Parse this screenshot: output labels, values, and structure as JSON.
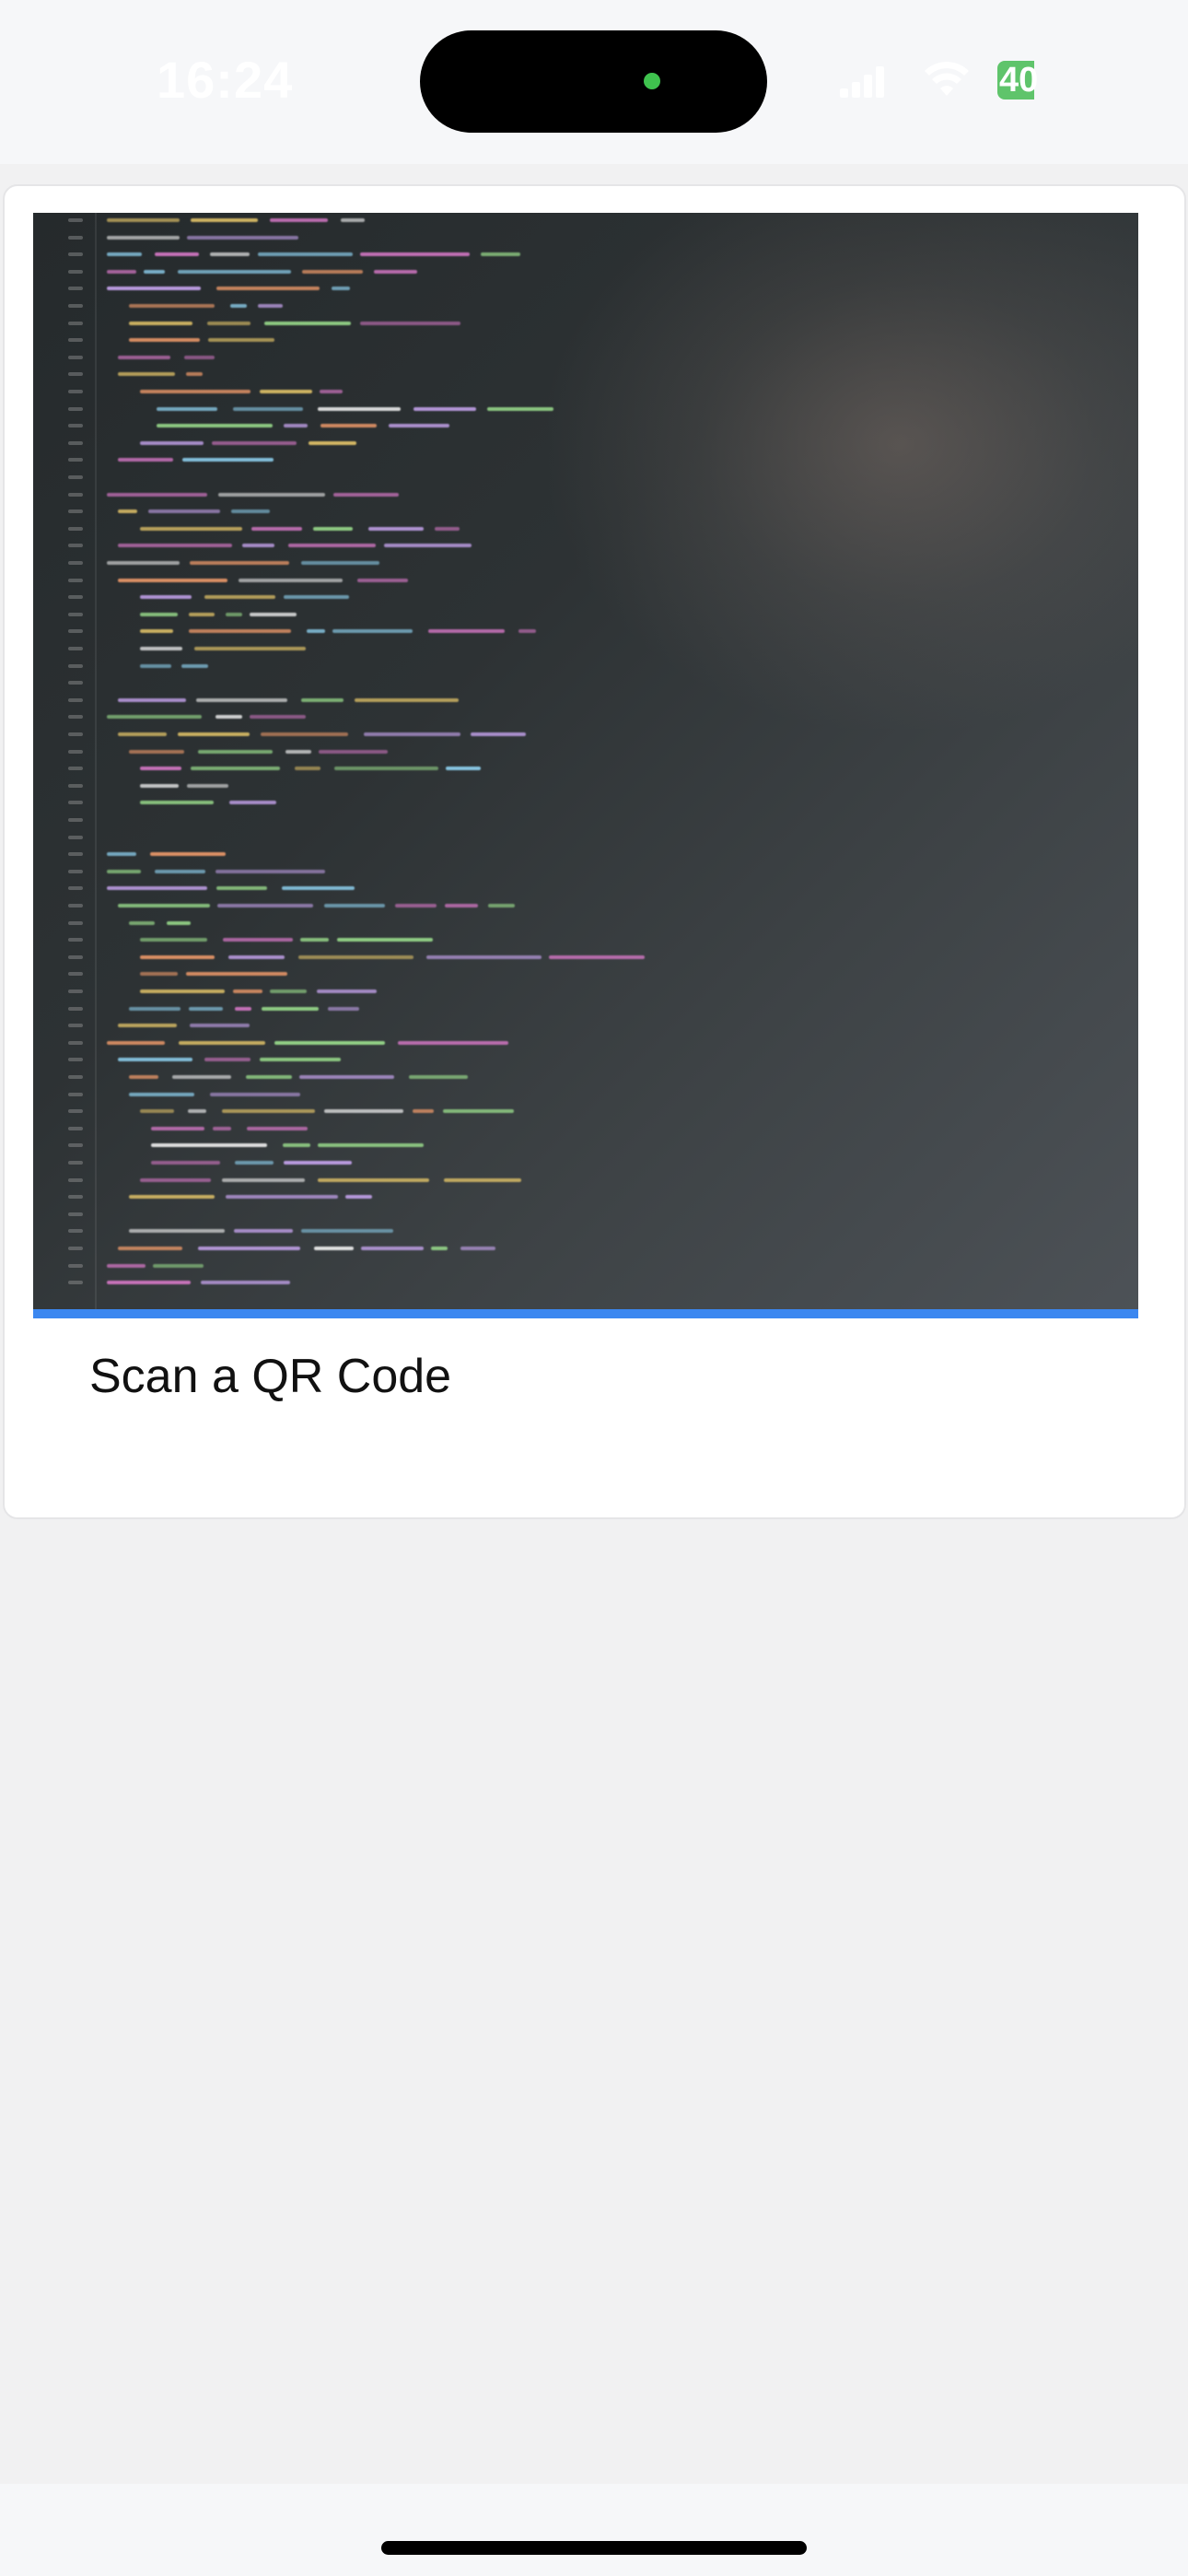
{
  "status_bar": {
    "time": "16:24",
    "battery_level": "40"
  },
  "card": {
    "title": "Scan a QR Code",
    "image_icon": "code-screenshot-photo",
    "accent_color": "#3b87f0"
  }
}
